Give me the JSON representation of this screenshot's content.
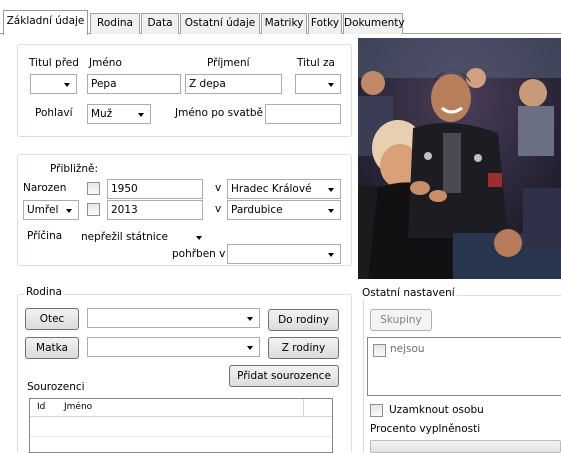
{
  "tabs": [
    {
      "label": "Základní údaje"
    },
    {
      "label": "Rodina"
    },
    {
      "label": "Data"
    },
    {
      "label": "Ostatní údaje"
    },
    {
      "label": "Matriky"
    },
    {
      "label": "Fotky"
    },
    {
      "label": "Dokumenty"
    }
  ],
  "identity": {
    "title_before_label": "Titul před",
    "first_name_label": "Jméno",
    "first_name_value": "Pepa",
    "surname_label": "Příjmení",
    "surname_value": "Z depa",
    "title_after_label": "Titul za",
    "sex_label": "Pohlaví",
    "sex_value": "Muž",
    "maiden_name_label": "Jméno po svatbě",
    "maiden_name_value": ""
  },
  "lifedata": {
    "approx_label": "Přibližně:",
    "born_label": "Narozen",
    "born_year": "1950",
    "born_place_prefix": "v",
    "born_place": "Hradec Králové",
    "died_label": "Umřel",
    "died_year": "2013",
    "died_place_prefix": "v",
    "died_place": "Pardubice",
    "cause_label": "Příčina",
    "cause_value": "nepřežil státnice",
    "buried_label": "pohřben v",
    "buried_value": ""
  },
  "family": {
    "legend": "Rodina",
    "father_button": "Otec",
    "father_value": "",
    "father_to_family": "Do rodiny",
    "mother_button": "Matka",
    "mother_value": "",
    "mother_from_family": "Z rodiny",
    "add_sibling": "Přidat sourozence",
    "siblings_label": "Sourozenci",
    "siblings_columns": [
      "Id",
      "Jméno"
    ]
  },
  "other_settings": {
    "legend": "Ostatní nastavení",
    "groups_button": "Skupiny",
    "groups_item": "nejsou",
    "lock_label": "Uzamknout osobu",
    "completeness_label": "Procento vyplněnosti",
    "completeness_value": 0
  }
}
